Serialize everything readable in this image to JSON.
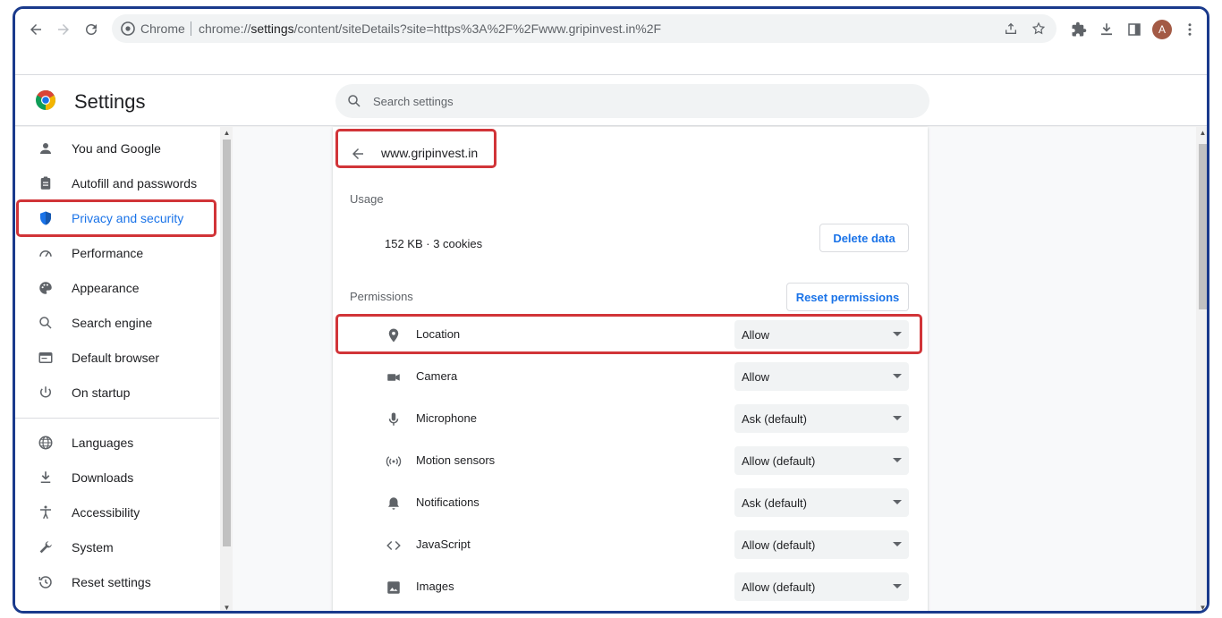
{
  "browser": {
    "omnibox_label": "Chrome",
    "url_prefix": "chrome://",
    "url_host": "settings",
    "url_rest": "/content/siteDetails?site=https%3A%2F%2Fwww.gripinvest.in%2F",
    "avatar_letter": "A"
  },
  "header": {
    "title": "Settings",
    "search_placeholder": "Search settings"
  },
  "sidebar": {
    "items": [
      {
        "label": "You and Google",
        "icon": "person-icon"
      },
      {
        "label": "Autofill and passwords",
        "icon": "clipboard-icon"
      },
      {
        "label": "Privacy and security",
        "icon": "shield-icon",
        "active": true
      },
      {
        "label": "Performance",
        "icon": "gauge-icon"
      },
      {
        "label": "Appearance",
        "icon": "palette-icon"
      },
      {
        "label": "Search engine",
        "icon": "search-icon"
      },
      {
        "label": "Default browser",
        "icon": "browser-icon"
      },
      {
        "label": "On startup",
        "icon": "power-icon"
      },
      {
        "label": "Languages",
        "icon": "globe-icon"
      },
      {
        "label": "Downloads",
        "icon": "download-icon"
      },
      {
        "label": "Accessibility",
        "icon": "accessibility-icon"
      },
      {
        "label": "System",
        "icon": "wrench-icon"
      },
      {
        "label": "Reset settings",
        "icon": "history-icon"
      }
    ]
  },
  "site": {
    "title": "www.gripinvest.in",
    "usage_label": "Usage",
    "usage_value": "152 KB · 3 cookies",
    "delete_button": "Delete data",
    "permissions_label": "Permissions",
    "reset_button": "Reset permissions",
    "permissions": [
      {
        "label": "Location",
        "value": "Allow",
        "icon": "location-pin-icon"
      },
      {
        "label": "Camera",
        "value": "Allow",
        "icon": "camera-icon"
      },
      {
        "label": "Microphone",
        "value": "Ask (default)",
        "icon": "microphone-icon"
      },
      {
        "label": "Motion sensors",
        "value": "Allow (default)",
        "icon": "motion-sensor-icon"
      },
      {
        "label": "Notifications",
        "value": "Ask (default)",
        "icon": "bell-icon"
      },
      {
        "label": "JavaScript",
        "value": "Allow (default)",
        "icon": "code-icon"
      },
      {
        "label": "Images",
        "value": "Allow (default)",
        "icon": "image-icon"
      }
    ]
  },
  "colors": {
    "accent": "#1a73e8",
    "highlight": "#d13438",
    "frame": "#1a3a8c"
  }
}
